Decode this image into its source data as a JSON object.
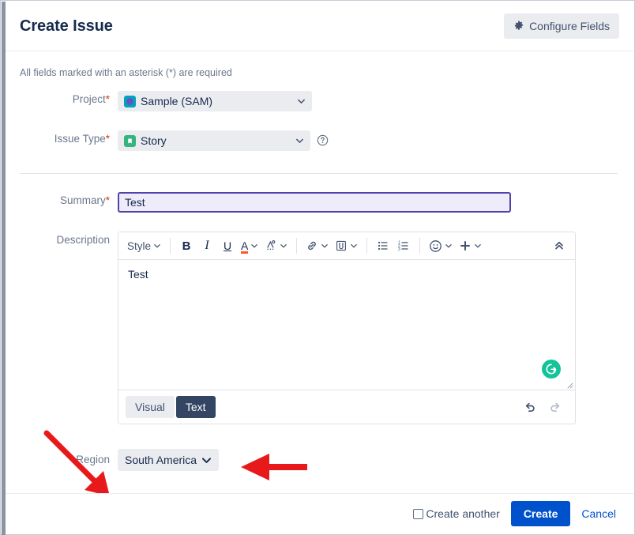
{
  "header": {
    "title": "Create Issue",
    "configure_fields_label": "Configure Fields",
    "gear_icon": "gear-icon"
  },
  "body": {
    "required_note": "All fields marked with an asterisk (*) are required",
    "required_marker": "*"
  },
  "fields": {
    "project": {
      "label": "Project",
      "required": true,
      "value": "Sample (SAM)",
      "icon": "project-avatar-icon"
    },
    "issue_type": {
      "label": "Issue Type",
      "required": true,
      "value": "Story",
      "icon": "story-type-icon",
      "help_icon": "help-circle-icon"
    },
    "summary": {
      "label": "Summary",
      "required": true,
      "value": "Test",
      "placeholder": ""
    },
    "description": {
      "label": "Description",
      "value": "Test",
      "grammarly_icon": "grammarly-icon",
      "grammarly_letter": "G"
    },
    "region": {
      "label": "Region",
      "required": false,
      "value": "South America",
      "chevron_icon": "chevron-down-icon"
    }
  },
  "editor_toolbar": {
    "style_label": "Style",
    "buttons": [
      {
        "name": "style-dropdown",
        "label": "Style",
        "icon": "style-text-icon",
        "has_caret": true
      },
      {
        "name": "bold-button",
        "label": "B",
        "icon": "bold-icon",
        "has_caret": false
      },
      {
        "name": "italic-button",
        "label": "I",
        "icon": "italic-icon",
        "has_caret": false
      },
      {
        "name": "underline-button",
        "label": "U",
        "icon": "underline-icon",
        "has_caret": false
      },
      {
        "name": "text-color-button",
        "label": "A",
        "icon": "text-color-icon",
        "has_caret": true
      },
      {
        "name": "text-highlight-button",
        "label": "A",
        "icon": "text-highlight-icon",
        "has_caret": true
      },
      {
        "name": "link-button",
        "label": "",
        "icon": "link-icon",
        "has_caret": true
      },
      {
        "name": "attachment-button",
        "label": "",
        "icon": "paperclip-icon",
        "has_caret": true
      },
      {
        "name": "bullet-list-button",
        "label": "",
        "icon": "bullet-list-icon",
        "has_caret": false
      },
      {
        "name": "numbered-list-button",
        "label": "",
        "icon": "numbered-list-icon",
        "has_caret": false
      },
      {
        "name": "emoji-button",
        "label": "",
        "icon": "smiley-icon",
        "has_caret": true
      },
      {
        "name": "insert-more-button",
        "label": "",
        "icon": "plus-icon",
        "has_caret": true
      }
    ],
    "collapse_icon": "double-chevron-up-icon"
  },
  "editor_footer": {
    "visual_tab": "Visual",
    "text_tab": "Text",
    "active_tab": "Text",
    "undo_icon": "undo-icon",
    "redo_icon": "redo-icon"
  },
  "footer": {
    "create_another_label": "Create another",
    "create_another_checked": false,
    "create_label": "Create",
    "cancel_label": "Cancel"
  },
  "annotations": [
    {
      "name": "annotation-arrow-diagonal",
      "direction": "down-right",
      "color": "#e8191b"
    },
    {
      "name": "annotation-arrow-left",
      "direction": "left",
      "color": "#e8191b"
    }
  ],
  "colors": {
    "accent_blue": "#0052cc",
    "summary_border": "#5243aa",
    "summary_bg": "#eeebfb",
    "active_tab_bg": "#344563",
    "control_bg": "#ebecf0",
    "annotation_red": "#e8191b",
    "required_red": "#de350b",
    "grammarly_green": "#15c39a",
    "story_green": "#36b37e",
    "project_teal": "#00a3bf"
  }
}
